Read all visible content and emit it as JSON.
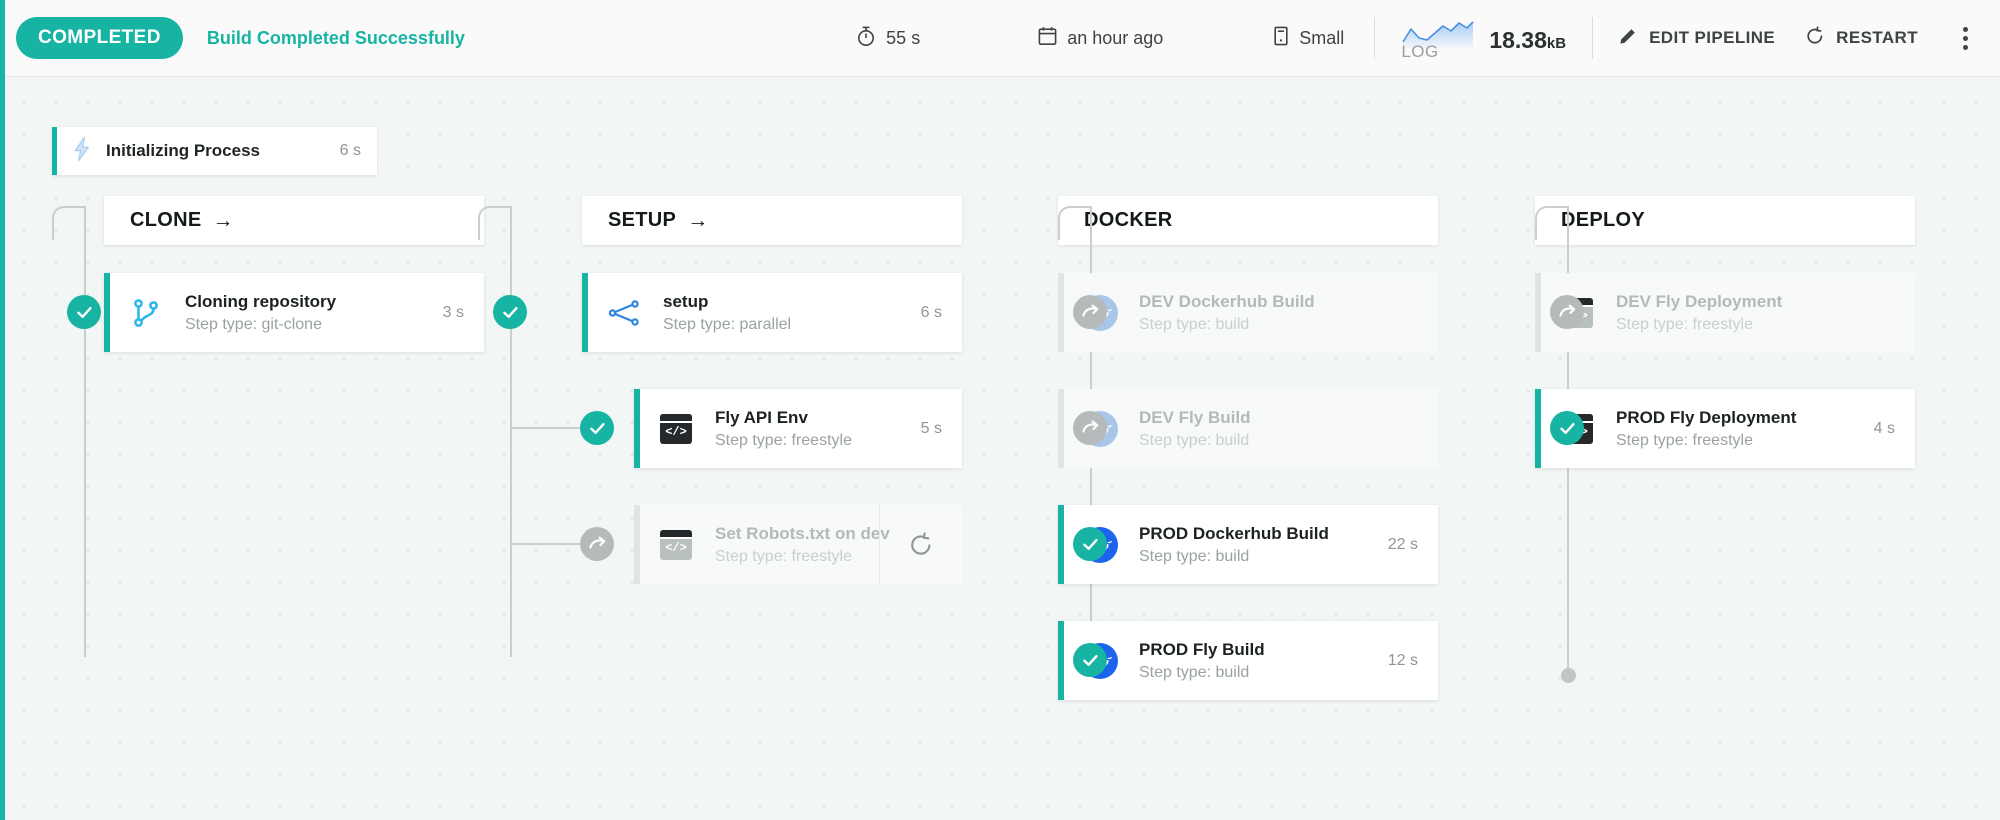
{
  "toolbar": {
    "status_badge": "COMPLETED",
    "status_message": "Build Completed Successfully",
    "duration": "55 s",
    "duration_icon": "stopwatch-icon",
    "time_ago": "an hour ago",
    "time_icon": "calendar-icon",
    "machine_size": "Small",
    "machine_icon": "server-icon",
    "log_caption": "LOG",
    "log_size_value": "18.38",
    "log_size_unit": "kB",
    "edit_pipeline_label": "EDIT PIPELINE",
    "edit_icon": "pencil-icon",
    "restart_label": "RESTART",
    "restart_icon": "restart-icon",
    "kebab_icon": "more-vertical-icon",
    "accent_color": "#17b3a3"
  },
  "init": {
    "label": "Initializing Process",
    "duration": "6 s",
    "icon": "lightning-bolt-icon"
  },
  "stages": [
    {
      "name": "CLONE",
      "has_arrow": true,
      "steps": [
        {
          "title": "Cloning repository",
          "subtitle": "Step type: git-clone",
          "duration": "3 s",
          "status": "success",
          "icon": "git-branch-icon",
          "indent": false,
          "restartable": false
        }
      ]
    },
    {
      "name": "SETUP",
      "has_arrow": true,
      "steps": [
        {
          "title": "setup",
          "subtitle": "Step type: parallel",
          "duration": "6 s",
          "status": "success",
          "icon": "parallel-share-icon",
          "indent": false,
          "restartable": false
        },
        {
          "title": "Fly API Env",
          "subtitle": "Step type: freestyle",
          "duration": "5 s",
          "status": "success",
          "icon": "freestyle-code-icon",
          "indent": true,
          "restartable": false
        },
        {
          "title": "Set Robots.txt on dev",
          "subtitle": "Step type: freestyle",
          "duration": "",
          "status": "skipped",
          "icon": "freestyle-code-icon",
          "indent": true,
          "restartable": true
        }
      ]
    },
    {
      "name": "DOCKER",
      "has_arrow": false,
      "steps": [
        {
          "title": "DEV Dockerhub Build",
          "subtitle": "Step type: build",
          "duration": "",
          "status": "skipped",
          "icon": "docker-icon",
          "indent": false,
          "restartable": false
        },
        {
          "title": "DEV Fly Build",
          "subtitle": "Step type: build",
          "duration": "",
          "status": "skipped",
          "icon": "docker-icon",
          "indent": false,
          "restartable": false
        },
        {
          "title": "PROD Dockerhub Build",
          "subtitle": "Step type: build",
          "duration": "22 s",
          "status": "success",
          "icon": "docker-icon",
          "indent": false,
          "restartable": false
        },
        {
          "title": "PROD Fly Build",
          "subtitle": "Step type: build",
          "duration": "12 s",
          "status": "success",
          "icon": "docker-icon",
          "indent": false,
          "restartable": false
        }
      ]
    },
    {
      "name": "DEPLOY",
      "has_arrow": false,
      "steps": [
        {
          "title": "DEV Fly Deployment",
          "subtitle": "Step type: freestyle",
          "duration": "",
          "status": "skipped",
          "icon": "freestyle-code-icon",
          "indent": false,
          "restartable": false
        },
        {
          "title": "PROD Fly Deployment",
          "subtitle": "Step type: freestyle",
          "duration": "4 s",
          "status": "success",
          "icon": "freestyle-code-icon",
          "indent": false,
          "restartable": false
        }
      ]
    }
  ]
}
